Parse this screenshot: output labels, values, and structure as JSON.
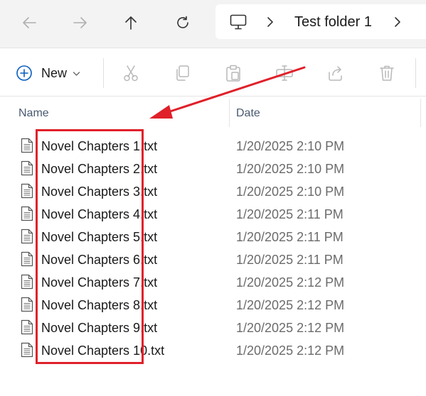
{
  "nav": {
    "back_icon": "arrow-left-icon",
    "forward_icon": "arrow-right-icon",
    "up_icon": "arrow-up-icon",
    "refresh_icon": "refresh-icon"
  },
  "address": {
    "root_icon": "this-pc-icon",
    "folder": "Test folder 1"
  },
  "commands": {
    "new_label": "New",
    "icons": [
      "cut-icon",
      "copy-icon",
      "paste-icon",
      "rename-icon",
      "share-icon",
      "delete-icon"
    ]
  },
  "columns": {
    "name": "Name",
    "date": "Date"
  },
  "files": [
    {
      "name": "Novel Chapters 1.txt",
      "date": "1/20/2025 2:10 PM"
    },
    {
      "name": "Novel Chapters 2.txt",
      "date": "1/20/2025 2:10 PM"
    },
    {
      "name": "Novel Chapters 3.txt",
      "date": "1/20/2025 2:10 PM"
    },
    {
      "name": "Novel Chapters 4.txt",
      "date": "1/20/2025 2:11 PM"
    },
    {
      "name": "Novel Chapters 5.txt",
      "date": "1/20/2025 2:11 PM"
    },
    {
      "name": "Novel Chapters 6.txt",
      "date": "1/20/2025 2:11 PM"
    },
    {
      "name": "Novel Chapters 7.txt",
      "date": "1/20/2025 2:12 PM"
    },
    {
      "name": "Novel Chapters 8.txt",
      "date": "1/20/2025 2:12 PM"
    },
    {
      "name": "Novel Chapters 9.txt",
      "date": "1/20/2025 2:12 PM"
    },
    {
      "name": "Novel Chapters 10.txt",
      "date": "1/20/2025 2:12 PM"
    }
  ],
  "colors": {
    "annotation": "#e0202a",
    "new_accent": "#0a5ebd",
    "disabled_icon": "#b8b8b8"
  }
}
